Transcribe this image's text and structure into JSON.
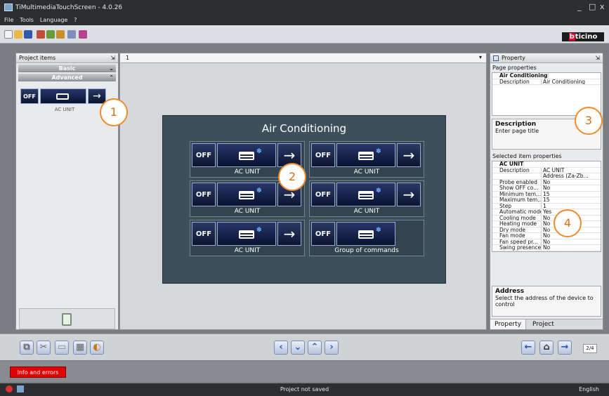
{
  "window": {
    "title": "TiMultimediaTouchScreen - 4.0.26",
    "min": "_",
    "max": "□",
    "close": "x"
  },
  "menu": [
    "File",
    "Tools",
    "Language",
    "?"
  ],
  "brand": {
    "logo_pre": "b",
    "logo_rest": "ticino"
  },
  "left_panel": {
    "title": "Project items",
    "pin": "⇲",
    "sections": [
      {
        "label": "Basic",
        "chevron": "⌄"
      },
      {
        "label": "Advanced",
        "chevron": "⌃"
      }
    ],
    "item_label": "AC UNIT",
    "item_off": "OFF",
    "item_arrow": "→"
  },
  "canvas": {
    "page_selector": "1",
    "dropdown": "▾",
    "page_title": "Air Conditioning"
  },
  "widgets": [
    {
      "off": "OFF",
      "arrow": "→",
      "label": "AC UNIT"
    },
    {
      "off": "OFF",
      "arrow": "→",
      "label": "AC UNIT"
    },
    {
      "off": "OFF",
      "arrow": "→",
      "label": "AC UNIT"
    },
    {
      "off": "OFF",
      "arrow": "→",
      "label": "AC UNIT"
    },
    {
      "off": "OFF",
      "arrow": "→",
      "label": "AC UNIT"
    },
    {
      "off": "OFF",
      "arrow": "",
      "label": "Group of commands"
    }
  ],
  "right_panel": {
    "title": "Property",
    "pin": "⇲",
    "page_props": "Page properties",
    "page_group": "Air Conditioning",
    "page_desc_key": "Description",
    "page_desc_val": "Air Conditioning",
    "desc_title": "Description",
    "desc_text": "Enter page title",
    "sel_props": "Selected item properties",
    "sel_group": "AC UNIT",
    "props": [
      [
        "Description",
        "AC UNIT"
      ],
      [
        "",
        "Address (Za-Zb..."
      ],
      [
        "Probe enabled",
        "No"
      ],
      [
        "Show OFF co...",
        "No"
      ],
      [
        "Minimum tem...",
        "15"
      ],
      [
        "Maximum tem...",
        "15"
      ],
      [
        "Step",
        "1"
      ],
      [
        "Automatic mode",
        "Yes"
      ],
      [
        "Cooling mode",
        "No"
      ],
      [
        "Heating mode",
        "No"
      ],
      [
        "Dry mode",
        "No"
      ],
      [
        "Fan mode",
        "No"
      ],
      [
        "Fan speed pr...",
        "No"
      ],
      [
        "Swing presence",
        "No"
      ]
    ],
    "addr_title": "Address",
    "addr_text": "Select the address of the device to control",
    "tabs": [
      "Property",
      "Project"
    ]
  },
  "bottom": {
    "page_counter": "2/4"
  },
  "info_button": "Info and errors",
  "status": {
    "center": "Project not saved",
    "right": "English"
  },
  "callouts": [
    "1",
    "2",
    "3",
    "4"
  ],
  "colors": {
    "accent_orange": "#f08a2a",
    "error_red": "#e30000",
    "panel_dark": "#3d4f59"
  }
}
